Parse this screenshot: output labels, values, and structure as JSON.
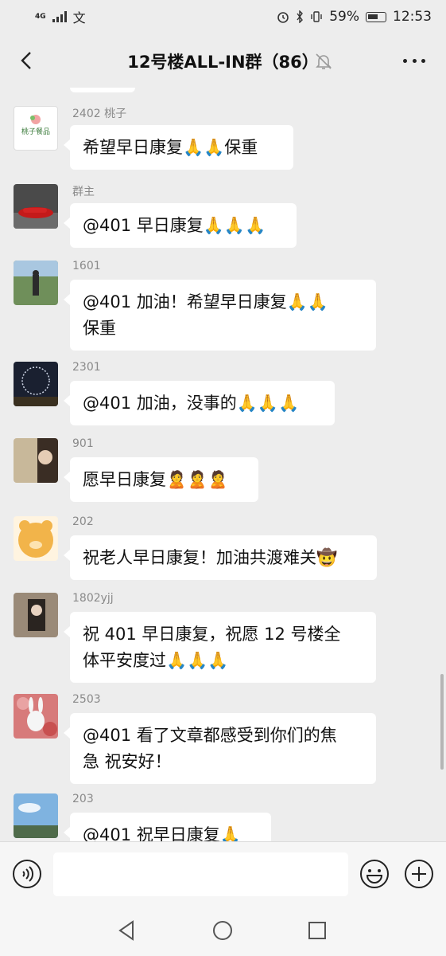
{
  "status_bar": {
    "network": "4G",
    "battery": "59%",
    "time": "12:53"
  },
  "nav": {
    "title": "12号楼ALL-IN群（86）"
  },
  "messages": [
    {
      "sender": "2402 桃子",
      "avatar_text": "桃子餐品",
      "lines": [
        "希望早日康复🙏🙏保重"
      ]
    },
    {
      "sender": "群主",
      "lines": [
        "@401  早日康复🙏🙏🙏"
      ]
    },
    {
      "sender": "1601",
      "lines": [
        "@401  加油！希望早日康复🙏🙏",
        "保重"
      ]
    },
    {
      "sender": "2301",
      "lines": [
        "@401  加油，没事的🙏🙏🙏"
      ]
    },
    {
      "sender": "901",
      "lines": [
        "愿早日康复🙎🙎🙎"
      ]
    },
    {
      "sender": "202",
      "lines": [
        "祝老人早日康复！加油共渡难关🤠"
      ]
    },
    {
      "sender": "1802yjj",
      "lines": [
        "祝 401 早日康复，祝愿 12 号楼全",
        "体平安度过🙏🙏🙏"
      ]
    },
    {
      "sender": "2503",
      "lines": [
        "@401  看了文章都感受到你们的焦",
        "急 祝安好！"
      ]
    },
    {
      "sender": "203",
      "lines": [
        "@401  祝早日康复🙏"
      ]
    }
  ],
  "input": {
    "placeholder": ""
  },
  "icons": {
    "back": "back-arrow-icon",
    "mute": "muted-bell-icon",
    "more": "more-dots-icon",
    "voice": "voice-icon",
    "emoji": "emoji-icon",
    "plus": "plus-icon"
  }
}
